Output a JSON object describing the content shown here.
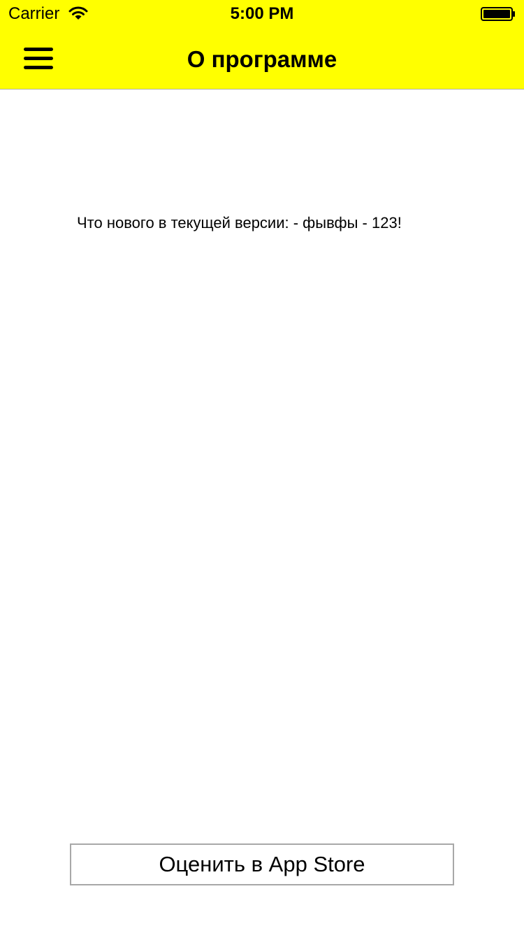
{
  "status_bar": {
    "carrier": "Carrier",
    "time": "5:00 PM",
    "wifi_icon": "wifi-icon",
    "battery_icon": "battery-full-icon"
  },
  "nav_bar": {
    "title": "О программе",
    "menu_icon": "hamburger-menu-icon",
    "background_color": "#ffff00"
  },
  "content": {
    "whats_new_text": "Что нового в текущей версии: - фывфы - 123!"
  },
  "actions": {
    "rate_button_label": "Оценить в App Store"
  }
}
